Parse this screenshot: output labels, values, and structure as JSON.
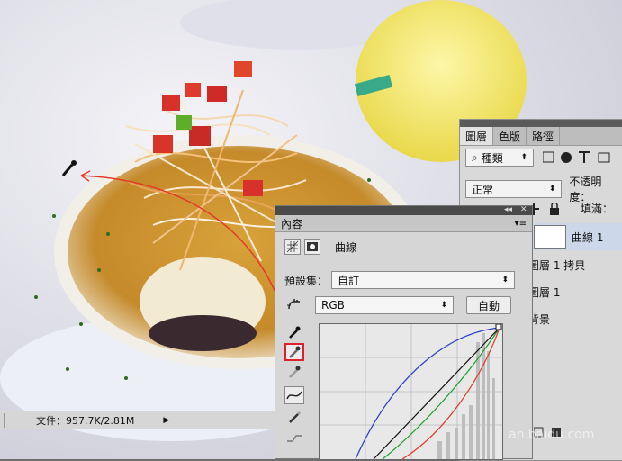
{
  "status_bar": {
    "doc_info": "文件：957.7K/2.81M",
    "menu_arrow": "▶"
  },
  "layers_panel": {
    "tabs": [
      {
        "label": "圖層"
      },
      {
        "label": "色版"
      },
      {
        "label": "路徑"
      }
    ],
    "filter": {
      "search_icon": "⌕",
      "kind_label": "種類"
    },
    "blend_mode": "正常",
    "opacity_label": "不透明度：",
    "lock_label": "鎖",
    "fill_label": "填滿：",
    "layers": [
      {
        "name": "曲線 1",
        "active": true
      },
      {
        "name": "圖層 1 拷貝"
      },
      {
        "name": "圖層 1"
      },
      {
        "name": "背景"
      }
    ]
  },
  "properties_panel": {
    "title": "內容",
    "collapse_glyph": "◂◂",
    "close_glyph": "✕",
    "menu_glyph": "▾≡",
    "adjustment_label": "曲線",
    "preset_label": "預設集：",
    "preset_value": "自訂",
    "channel_value": "RGB",
    "auto_button": "自動"
  },
  "watermark": "an.baidu.com",
  "colors": {
    "red_curve": "#e23a2a",
    "green_curve": "#1a9e2a",
    "blue_curve": "#2b3fc7",
    "highlight": "#e0202a"
  }
}
